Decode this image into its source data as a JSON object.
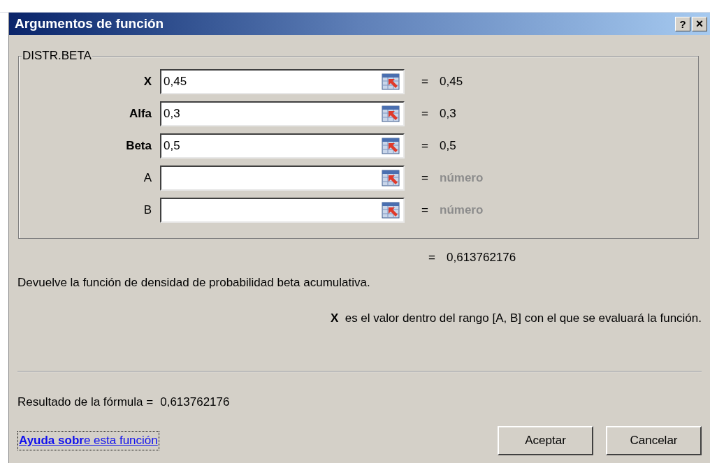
{
  "window": {
    "title": "Argumentos de función",
    "help_button": "?",
    "close_button": "×"
  },
  "group": {
    "title": "DISTR.BETA"
  },
  "arguments": [
    {
      "name": "X",
      "required": true,
      "value": "0,45",
      "equals": "=",
      "result": "0,45",
      "kind": "value"
    },
    {
      "name": "Alfa",
      "required": true,
      "value": "0,3",
      "equals": "=",
      "result": "0,3",
      "kind": "value"
    },
    {
      "name": "Beta",
      "required": true,
      "value": "0,5",
      "equals": "=",
      "result": "0,5",
      "kind": "value"
    },
    {
      "name": "A",
      "required": false,
      "equals": "=",
      "result": "número",
      "kind": "hint"
    },
    {
      "name": "B",
      "required": false,
      "equals": "=",
      "result": "número",
      "kind": "hint"
    }
  ],
  "function_result": {
    "equals": "=",
    "value": "0,613762176"
  },
  "description": "Devuelve la función de densidad de probabilidad beta acumulativa.",
  "argument_help": "**X**  es el valor dentro del rango [A, B] con el que se evaluará la función.",
  "formula_result": {
    "label": "Resultado de la fórmula =",
    "value": "0,613762176"
  },
  "help_link": "**Ayuda sobr**e esta función",
  "buttons": [
    "Aceptar",
    "Cancelar"
  ]
}
